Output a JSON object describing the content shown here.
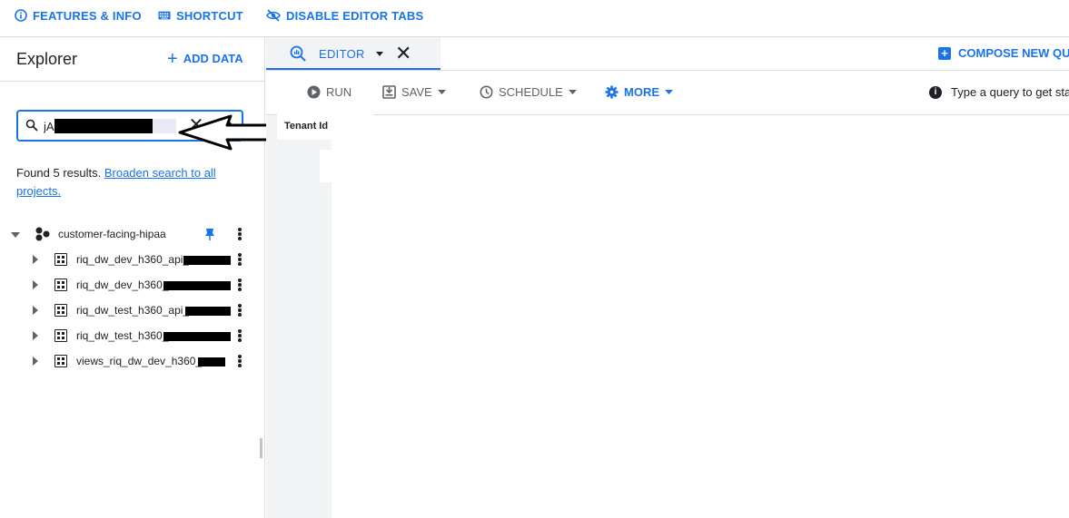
{
  "topbar": {
    "features_label": "FEATURES & INFO",
    "shortcut_label": "SHORTCUT",
    "disable_tabs_label": "DISABLE EDITOR TABS"
  },
  "explorer": {
    "title": "Explorer",
    "add_data_label": "ADD DATA",
    "search_value": "jA",
    "results_text": "Found 5 results.",
    "broaden_link": "Broaden search to all projects.",
    "project": {
      "name": "customer-facing-hipaa"
    },
    "datasets": [
      {
        "label": "riq_dw_dev_h360_api_"
      },
      {
        "label": "riq_dw_dev_h360_"
      },
      {
        "label": "riq_dw_test_h360_api_"
      },
      {
        "label": "riq_dw_test_h360_"
      },
      {
        "label": "views_riq_dw_dev_h360_"
      }
    ]
  },
  "editor": {
    "tab_label": "EDITOR",
    "compose_label": "COMPOSE NEW QUE",
    "run_label": "RUN",
    "save_label": "SAVE",
    "schedule_label": "SCHEDULE",
    "more_label": "MORE",
    "hint_text": "Type a query to get sta",
    "column_header": "Tenant Id"
  },
  "colors": {
    "accent": "#1a73e8",
    "text": "#202124",
    "muted": "#5f6368",
    "border": "#dadce0"
  }
}
